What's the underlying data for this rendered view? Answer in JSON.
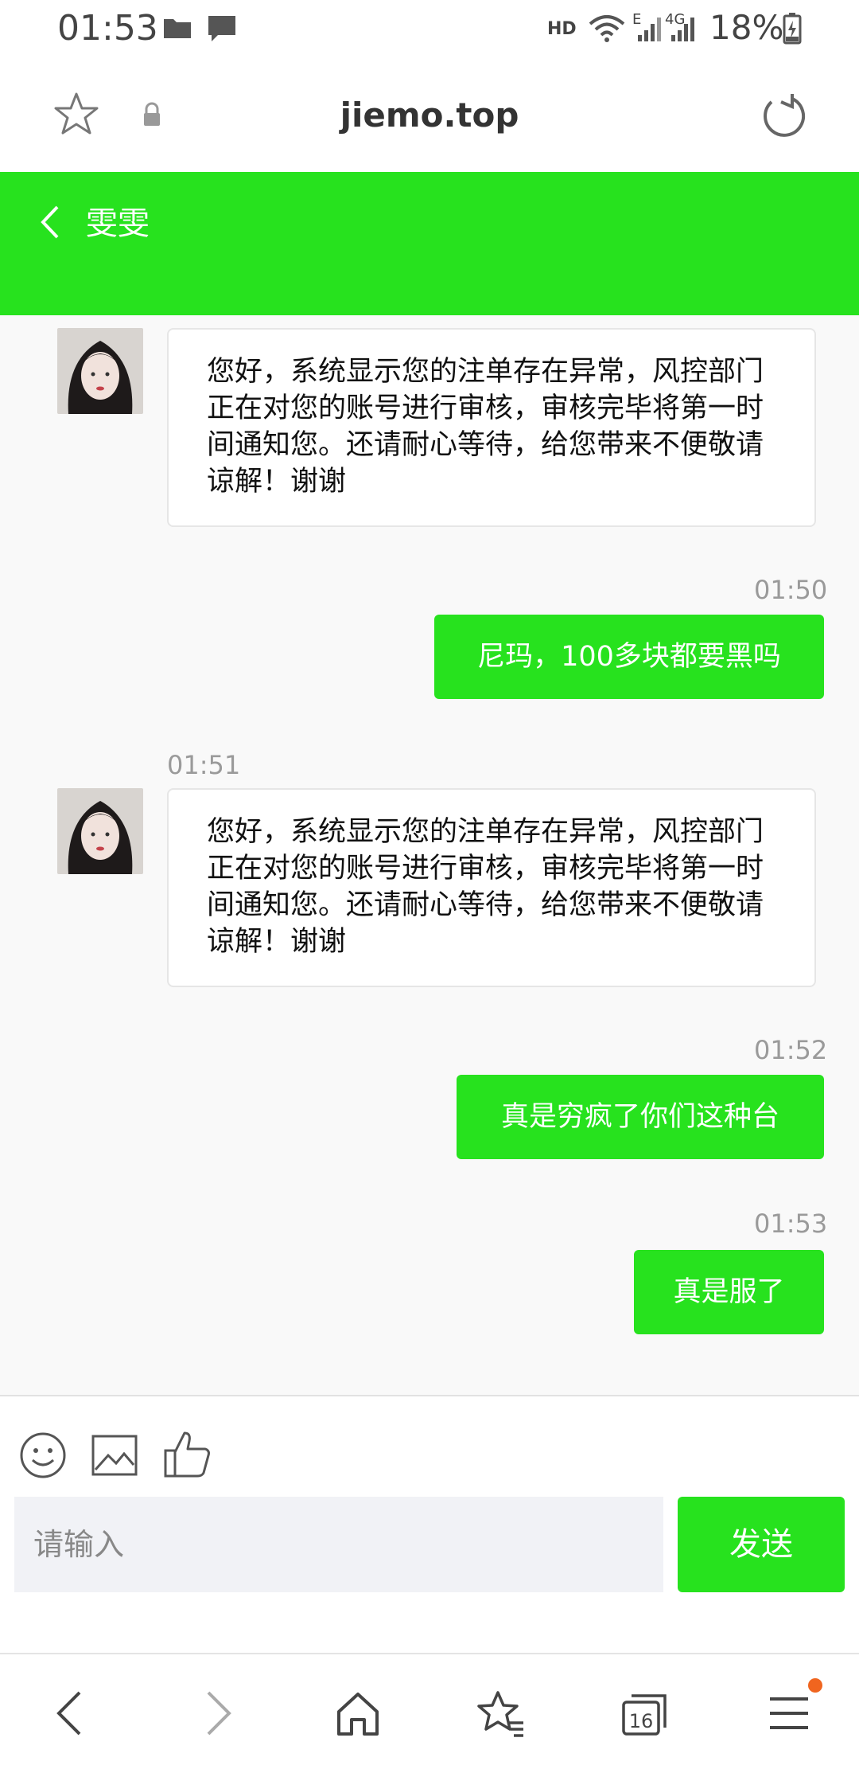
{
  "status_bar": {
    "time": "01:53",
    "network_hd": "HD",
    "network_e": "E",
    "network_4g": "4G",
    "battery": "18%"
  },
  "browser": {
    "url": "jiemo.top"
  },
  "chat": {
    "contact_name": "雯雯",
    "messages": [
      {
        "direction": "incoming",
        "time": "",
        "text": "您好，系统显示您的注单存在异常，风控部门正在对您的账号进行审核，审核完毕将第一时间通知您。还请耐心等待，给您带来不便敬请谅解！谢谢"
      },
      {
        "direction": "outgoing",
        "time": "01:50",
        "text": "尼玛，100多块都要黑吗"
      },
      {
        "direction": "incoming",
        "time": "01:51",
        "text": "您好，系统显示您的注单存在异常，风控部门正在对您的账号进行审核，审核完毕将第一时间通知您。还请耐心等待，给您带来不便敬请谅解！谢谢"
      },
      {
        "direction": "outgoing",
        "time": "01:52",
        "text": "真是穷疯了你们这种台"
      },
      {
        "direction": "outgoing",
        "time": "01:53",
        "text": "真是服了"
      }
    ]
  },
  "composer": {
    "placeholder": "请输入",
    "send_label": "发送",
    "toolbar_icons": [
      "emoji-icon",
      "image-icon",
      "thumbs-up-icon"
    ]
  },
  "nav": {
    "tab_count": "16"
  },
  "colors": {
    "accent": "#27e21e",
    "notification_dot": "#f0651f"
  }
}
